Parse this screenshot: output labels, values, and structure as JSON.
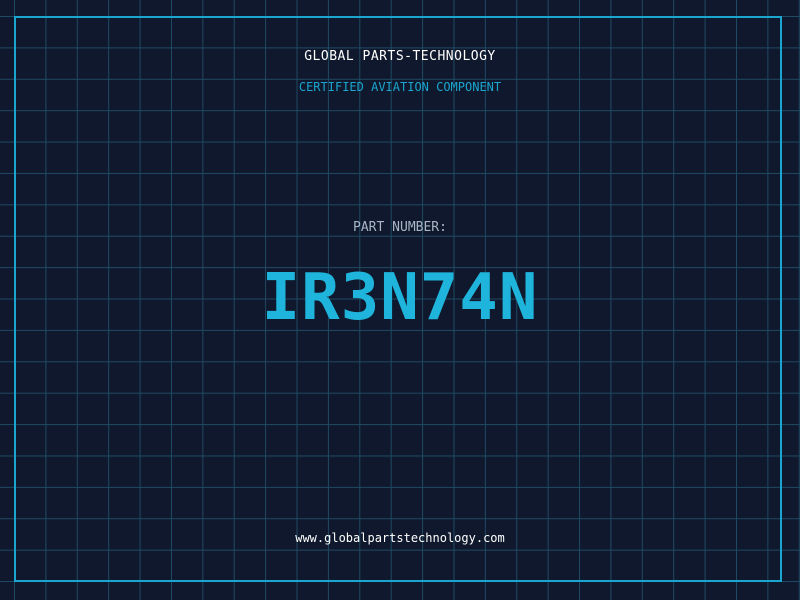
{
  "header": {
    "brand": "GLOBAL PARTS-TECHNOLOGY",
    "subtitle": "CERTIFIED AVIATION COMPONENT"
  },
  "part": {
    "label": "PART NUMBER:",
    "number": "IR3N74N"
  },
  "footer": {
    "url": "www.globalpartstechnology.com"
  },
  "colors": {
    "background": "#0f182c",
    "grid": "#1f4a63",
    "accent": "#1aa6cf",
    "part_number": "#1fb4dc",
    "label": "#a9b6c8",
    "text": "#ffffff"
  }
}
